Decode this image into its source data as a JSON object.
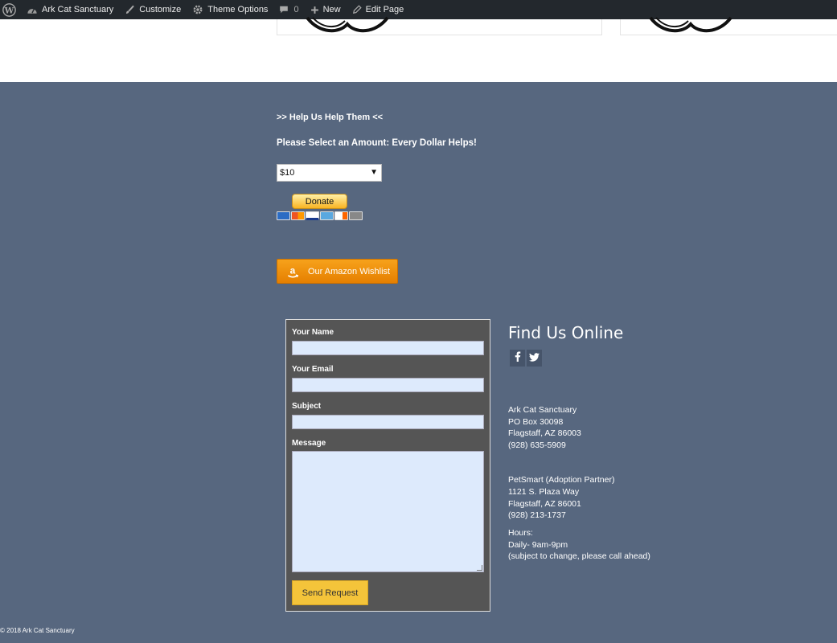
{
  "admin_bar": {
    "site_name": "Ark Cat Sanctuary",
    "customize": "Customize",
    "theme_options": "Theme Options",
    "comments_count": "0",
    "new": "New",
    "edit_page": "Edit Page",
    "icons": [
      "wordpress-icon",
      "dashboard-icon",
      "brush-icon",
      "gear-icon",
      "comment-icon",
      "plus-icon",
      "pencil-icon"
    ],
    "bg_color": "#23282d"
  },
  "donate": {
    "heading": ">> Help Us Help Them <<",
    "subheading": "Please Select an Amount: Every Dollar Helps!",
    "selected_amount": "$10",
    "button_label": "Donate",
    "card_icons": [
      "amex-icon",
      "mastercard-icon",
      "visa-icon",
      "amex-blue-icon",
      "discover-icon",
      "bank-icon"
    ]
  },
  "amazon": {
    "label": "Our Amazon Wishlist",
    "color": "#f29611"
  },
  "contact_form": {
    "name_label": "Your Name",
    "email_label": "Your Email",
    "subject_label": "Subject",
    "message_label": "Message",
    "submit_label": "Send Request",
    "submit_color": "#f4c43a"
  },
  "find_us": {
    "title": "Find Us Online",
    "social_icons": [
      "facebook-icon",
      "twitter-icon"
    ],
    "address1": [
      "Ark Cat Sanctuary",
      "PO Box  30098",
      "Flagstaff, AZ  86003",
      "(928) 635-5909"
    ],
    "address2": [
      "PetSmart (Adoption Partner)",
      "1121 S. Plaza Way",
      "Flagstaff, AZ  86001",
      "(928) 213-1737"
    ],
    "hours": [
      "Hours:",
      "Daily- 9am-9pm",
      "(subject to change, please call ahead)"
    ]
  },
  "footer": {
    "copyright": "© 2018 Ark Cat Sanctuary",
    "bg_color": "#57677f"
  }
}
